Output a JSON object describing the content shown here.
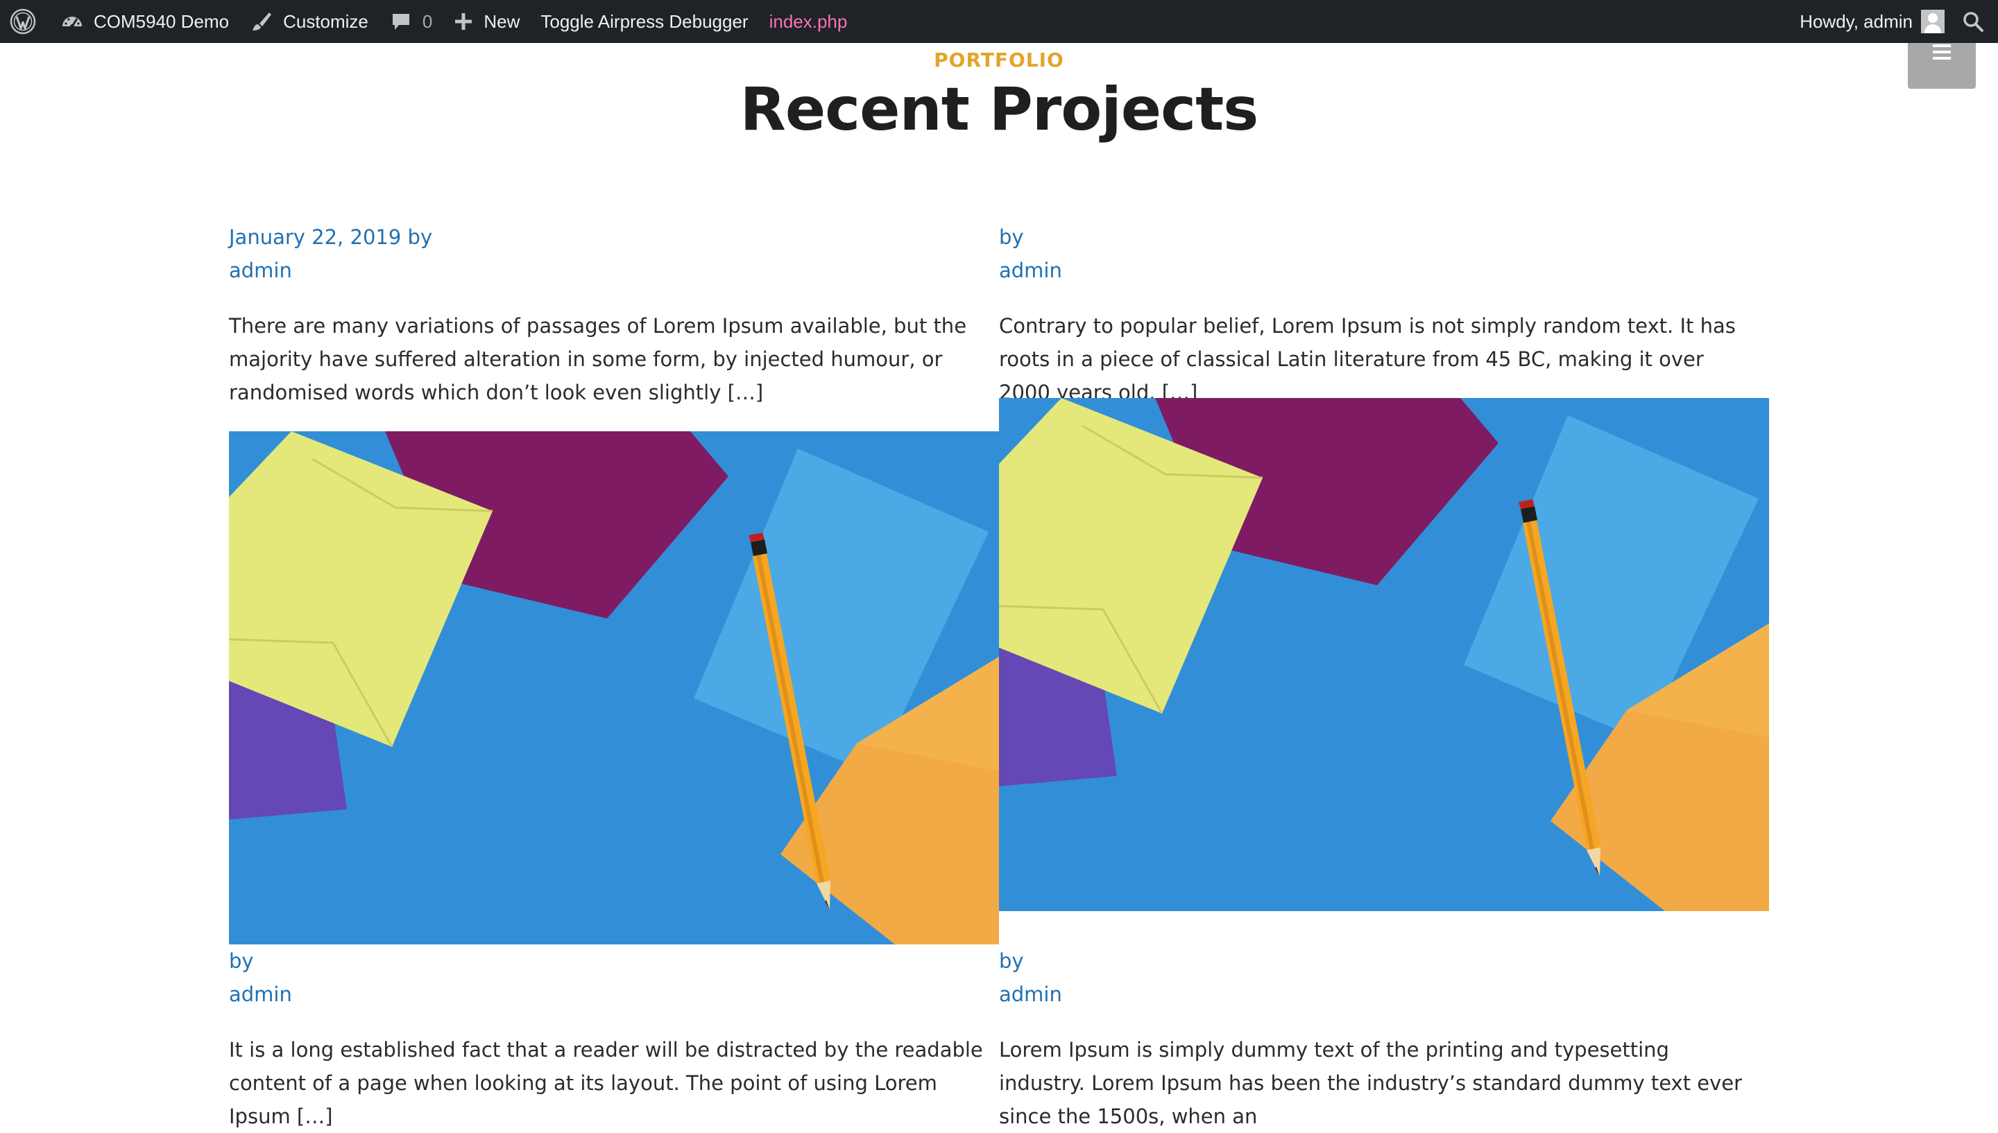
{
  "admin_bar": {
    "site_name": "COM5940 Demo",
    "customize": "Customize",
    "comments_count": "0",
    "new_label": "New",
    "debugger_label": "Toggle Airpress Debugger",
    "template_file": "index.php",
    "greeting": "Howdy, admin"
  },
  "section": {
    "eyebrow": "PORTFOLIO",
    "title": "Recent Projects"
  },
  "colors": {
    "accent": "#e2a52c",
    "link": "#2271b1",
    "admin_bar_bg": "#1d2327",
    "template_file": "#ff6fb5"
  },
  "posts": [
    {
      "date": "January 22, 2019",
      "by": "by",
      "author": "admin",
      "excerpt": "There are many variations of passages of Lorem Ipsum available, but the majority have suffered alteration in some form, by injected humour, or randomised words which don’t look even slightly […]"
    },
    {
      "date": "",
      "by": "by",
      "author": "admin",
      "excerpt": "Contrary to popular belief, Lorem Ipsum is not simply random text. It has roots in a piece of classical Latin literature from 45 BC, making it over 2000 years old. […]"
    },
    {
      "date": "",
      "by": "by",
      "author": "admin",
      "excerpt": "It is a long established fact that a reader will be distracted by the readable content of a page when looking at its layout. The point of using Lorem Ipsum […]"
    },
    {
      "date": "",
      "by": "by",
      "author": "admin",
      "excerpt": "Lorem Ipsum is simply dummy text of the printing and typesetting industry. Lorem Ipsum has been the industry’s standard dummy text ever since the 1500s, when an"
    }
  ]
}
